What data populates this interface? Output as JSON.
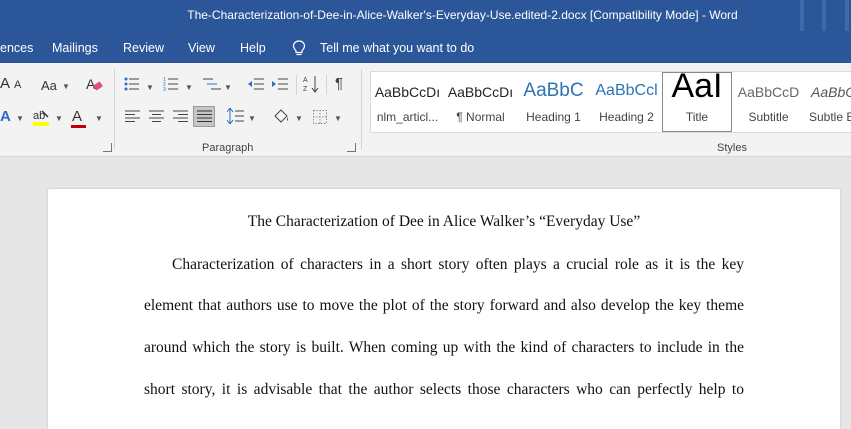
{
  "window": {
    "title": "The-Characterization-of-Dee-in-Alice-Walker's-Everyday-Use.edited-2.docx [Compatibility Mode]  -  Word"
  },
  "tabs": [
    "ences",
    "Mailings",
    "Review",
    "View",
    "Help"
  ],
  "tell_me": "Tell me what you want to do",
  "ribbon": {
    "font_group": {
      "grow_font": "A",
      "shrink_font": "A",
      "change_case": "Aa",
      "text_effects": "A",
      "font_color": "A",
      "highlight_color": "#ffff00",
      "font_color_value": "#c00000"
    },
    "paragraph_label": "Paragraph",
    "styles_label": "Styles",
    "styles": [
      {
        "preview": "AaBbCcDı",
        "name": "nlm_articl..."
      },
      {
        "preview": "AaBbCcDı",
        "name": "¶ Normal"
      },
      {
        "preview": "AaBbC",
        "name": "Heading 1"
      },
      {
        "preview": "AaBbCcl",
        "name": "Heading 2"
      },
      {
        "preview": "AaI",
        "name": "Title"
      },
      {
        "preview": "AaBbCcD",
        "name": "Subtitle"
      },
      {
        "preview": "AaBbC",
        "name": "Subtle E"
      }
    ],
    "selected_style": "Title"
  },
  "document": {
    "title": "The Characterization of Dee in Alice Walker’s “Everyday Use”",
    "lines": [
      "Characterization of characters in a short story often plays a crucial role as it is the key",
      "element that authors use to move the plot of the story forward and also develop the key theme",
      "around which the story is built. When coming up with the kind of characters to include in the",
      "short story, it is advisable that the author selects those characters who can perfectly help to"
    ]
  }
}
